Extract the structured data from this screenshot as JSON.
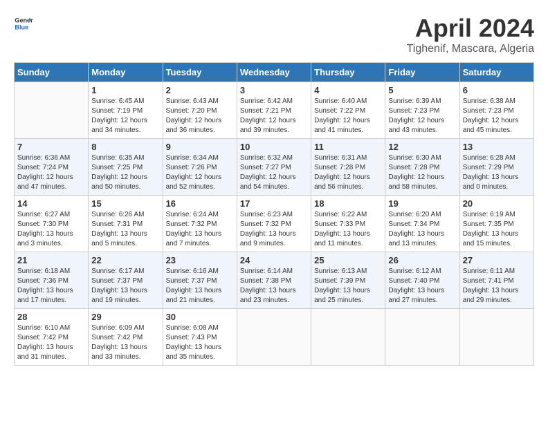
{
  "header": {
    "logo_line1": "General",
    "logo_line2": "Blue",
    "title": "April 2024",
    "location": "Tighenif, Mascara, Algeria"
  },
  "calendar": {
    "weekdays": [
      "Sunday",
      "Monday",
      "Tuesday",
      "Wednesday",
      "Thursday",
      "Friday",
      "Saturday"
    ],
    "weeks": [
      [
        {
          "day": "",
          "sunrise": "",
          "sunset": "",
          "daylight": ""
        },
        {
          "day": "1",
          "sunrise": "Sunrise: 6:45 AM",
          "sunset": "Sunset: 7:19 PM",
          "daylight": "Daylight: 12 hours and 34 minutes."
        },
        {
          "day": "2",
          "sunrise": "Sunrise: 6:43 AM",
          "sunset": "Sunset: 7:20 PM",
          "daylight": "Daylight: 12 hours and 36 minutes."
        },
        {
          "day": "3",
          "sunrise": "Sunrise: 6:42 AM",
          "sunset": "Sunset: 7:21 PM",
          "daylight": "Daylight: 12 hours and 39 minutes."
        },
        {
          "day": "4",
          "sunrise": "Sunrise: 6:40 AM",
          "sunset": "Sunset: 7:22 PM",
          "daylight": "Daylight: 12 hours and 41 minutes."
        },
        {
          "day": "5",
          "sunrise": "Sunrise: 6:39 AM",
          "sunset": "Sunset: 7:23 PM",
          "daylight": "Daylight: 12 hours and 43 minutes."
        },
        {
          "day": "6",
          "sunrise": "Sunrise: 6:38 AM",
          "sunset": "Sunset: 7:23 PM",
          "daylight": "Daylight: 12 hours and 45 minutes."
        }
      ],
      [
        {
          "day": "7",
          "sunrise": "Sunrise: 6:36 AM",
          "sunset": "Sunset: 7:24 PM",
          "daylight": "Daylight: 12 hours and 47 minutes."
        },
        {
          "day": "8",
          "sunrise": "Sunrise: 6:35 AM",
          "sunset": "Sunset: 7:25 PM",
          "daylight": "Daylight: 12 hours and 50 minutes."
        },
        {
          "day": "9",
          "sunrise": "Sunrise: 6:34 AM",
          "sunset": "Sunset: 7:26 PM",
          "daylight": "Daylight: 12 hours and 52 minutes."
        },
        {
          "day": "10",
          "sunrise": "Sunrise: 6:32 AM",
          "sunset": "Sunset: 7:27 PM",
          "daylight": "Daylight: 12 hours and 54 minutes."
        },
        {
          "day": "11",
          "sunrise": "Sunrise: 6:31 AM",
          "sunset": "Sunset: 7:28 PM",
          "daylight": "Daylight: 12 hours and 56 minutes."
        },
        {
          "day": "12",
          "sunrise": "Sunrise: 6:30 AM",
          "sunset": "Sunset: 7:28 PM",
          "daylight": "Daylight: 12 hours and 58 minutes."
        },
        {
          "day": "13",
          "sunrise": "Sunrise: 6:28 AM",
          "sunset": "Sunset: 7:29 PM",
          "daylight": "Daylight: 13 hours and 0 minutes."
        }
      ],
      [
        {
          "day": "14",
          "sunrise": "Sunrise: 6:27 AM",
          "sunset": "Sunset: 7:30 PM",
          "daylight": "Daylight: 13 hours and 3 minutes."
        },
        {
          "day": "15",
          "sunrise": "Sunrise: 6:26 AM",
          "sunset": "Sunset: 7:31 PM",
          "daylight": "Daylight: 13 hours and 5 minutes."
        },
        {
          "day": "16",
          "sunrise": "Sunrise: 6:24 AM",
          "sunset": "Sunset: 7:32 PM",
          "daylight": "Daylight: 13 hours and 7 minutes."
        },
        {
          "day": "17",
          "sunrise": "Sunrise: 6:23 AM",
          "sunset": "Sunset: 7:32 PM",
          "daylight": "Daylight: 13 hours and 9 minutes."
        },
        {
          "day": "18",
          "sunrise": "Sunrise: 6:22 AM",
          "sunset": "Sunset: 7:33 PM",
          "daylight": "Daylight: 13 hours and 11 minutes."
        },
        {
          "day": "19",
          "sunrise": "Sunrise: 6:20 AM",
          "sunset": "Sunset: 7:34 PM",
          "daylight": "Daylight: 13 hours and 13 minutes."
        },
        {
          "day": "20",
          "sunrise": "Sunrise: 6:19 AM",
          "sunset": "Sunset: 7:35 PM",
          "daylight": "Daylight: 13 hours and 15 minutes."
        }
      ],
      [
        {
          "day": "21",
          "sunrise": "Sunrise: 6:18 AM",
          "sunset": "Sunset: 7:36 PM",
          "daylight": "Daylight: 13 hours and 17 minutes."
        },
        {
          "day": "22",
          "sunrise": "Sunrise: 6:17 AM",
          "sunset": "Sunset: 7:37 PM",
          "daylight": "Daylight: 13 hours and 19 minutes."
        },
        {
          "day": "23",
          "sunrise": "Sunrise: 6:16 AM",
          "sunset": "Sunset: 7:37 PM",
          "daylight": "Daylight: 13 hours and 21 minutes."
        },
        {
          "day": "24",
          "sunrise": "Sunrise: 6:14 AM",
          "sunset": "Sunset: 7:38 PM",
          "daylight": "Daylight: 13 hours and 23 minutes."
        },
        {
          "day": "25",
          "sunrise": "Sunrise: 6:13 AM",
          "sunset": "Sunset: 7:39 PM",
          "daylight": "Daylight: 13 hours and 25 minutes."
        },
        {
          "day": "26",
          "sunrise": "Sunrise: 6:12 AM",
          "sunset": "Sunset: 7:40 PM",
          "daylight": "Daylight: 13 hours and 27 minutes."
        },
        {
          "day": "27",
          "sunrise": "Sunrise: 6:11 AM",
          "sunset": "Sunset: 7:41 PM",
          "daylight": "Daylight: 13 hours and 29 minutes."
        }
      ],
      [
        {
          "day": "28",
          "sunrise": "Sunrise: 6:10 AM",
          "sunset": "Sunset: 7:42 PM",
          "daylight": "Daylight: 13 hours and 31 minutes."
        },
        {
          "day": "29",
          "sunrise": "Sunrise: 6:09 AM",
          "sunset": "Sunset: 7:42 PM",
          "daylight": "Daylight: 13 hours and 33 minutes."
        },
        {
          "day": "30",
          "sunrise": "Sunrise: 6:08 AM",
          "sunset": "Sunset: 7:43 PM",
          "daylight": "Daylight: 13 hours and 35 minutes."
        },
        {
          "day": "",
          "sunrise": "",
          "sunset": "",
          "daylight": ""
        },
        {
          "day": "",
          "sunrise": "",
          "sunset": "",
          "daylight": ""
        },
        {
          "day": "",
          "sunrise": "",
          "sunset": "",
          "daylight": ""
        },
        {
          "day": "",
          "sunrise": "",
          "sunset": "",
          "daylight": ""
        }
      ]
    ]
  }
}
